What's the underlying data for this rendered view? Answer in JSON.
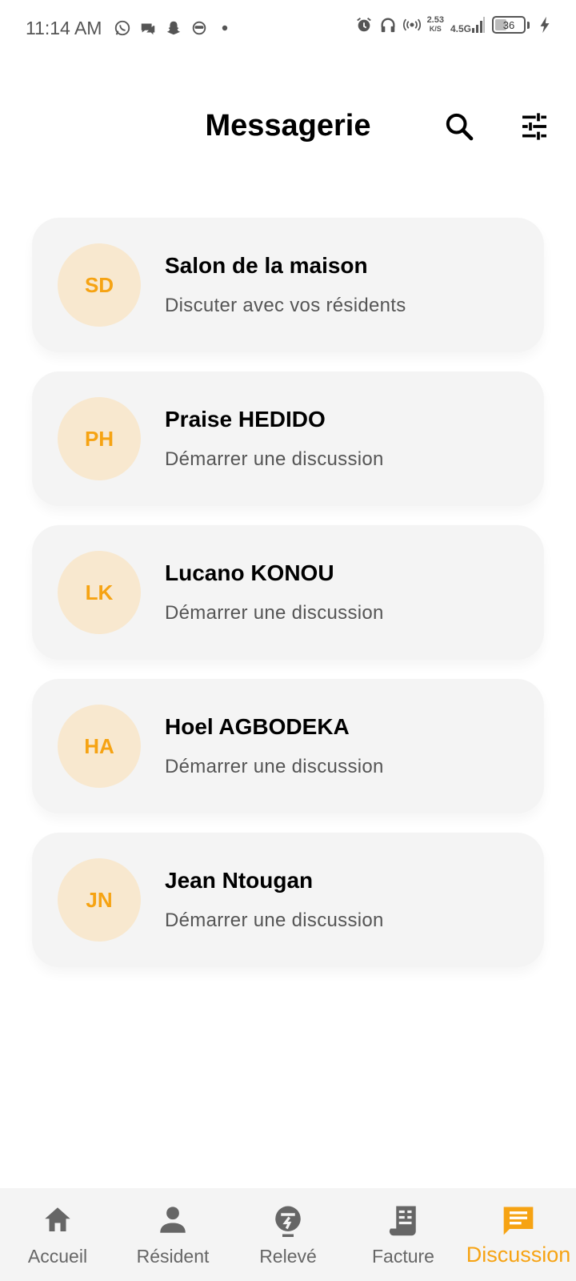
{
  "status_bar": {
    "time": "11:14 AM",
    "net_speed_value": "2.53",
    "net_speed_unit": "K/S",
    "network_type": "4.5G",
    "battery_level": "36",
    "battery_fraction": 0.36,
    "left_icons": [
      "whatsapp-icon",
      "chat-bubble-icon",
      "snapchat-icon",
      "face-icon",
      "dot-icon"
    ],
    "right_icons": [
      "alarm-icon",
      "headphones-icon",
      "hotspot-icon",
      "signal-icon",
      "battery-icon",
      "charging-icon"
    ]
  },
  "header": {
    "title": "Messagerie",
    "search_icon": "search-icon",
    "filter_icon": "tune-icon"
  },
  "conversations": [
    {
      "initials": "SD",
      "name": "Salon de la maison",
      "subtitle": "Discuter avec vos résidents"
    },
    {
      "initials": "PH",
      "name": "Praise HEDIDO",
      "subtitle": "Démarrer une discussion"
    },
    {
      "initials": "LK",
      "name": "Lucano KONOU",
      "subtitle": "Démarrer une discussion"
    },
    {
      "initials": "HA",
      "name": "Hoel AGBODEKA",
      "subtitle": "Démarrer une discussion"
    },
    {
      "initials": "JN",
      "name": "Jean Ntougan",
      "subtitle": "Démarrer une discussion"
    }
  ],
  "bottom_nav": {
    "items": [
      {
        "label": "Accueil",
        "icon": "home-icon",
        "active": false
      },
      {
        "label": "Résident",
        "icon": "person-icon",
        "active": false
      },
      {
        "label": "Relevé",
        "icon": "meter-icon",
        "active": false
      },
      {
        "label": "Facture",
        "icon": "receipt-icon",
        "active": false
      },
      {
        "label": "Discussion",
        "icon": "chat-icon",
        "active": true
      }
    ]
  },
  "colors": {
    "accent": "#f6a313",
    "avatar_bg": "#f8e8cf",
    "card_bg": "#f4f4f4",
    "nav_bg": "#f4f4f4",
    "icon_gray": "#666666"
  }
}
